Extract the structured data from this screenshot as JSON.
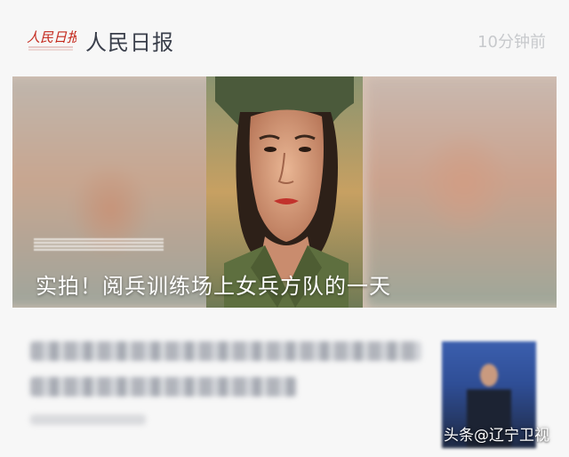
{
  "header": {
    "source_name": "人民日报",
    "timestamp": "10分钟前"
  },
  "hero": {
    "caption": "实拍！阅兵训练场上女兵方队的一天"
  },
  "watermark": "头条@辽宁卫视",
  "colors": {
    "background": "#f7f7f7",
    "logo_red": "#c4281c",
    "source_text": "#3a3f4b",
    "timestamp_text": "#c7c9cc",
    "caption_text": "#ffffff"
  }
}
